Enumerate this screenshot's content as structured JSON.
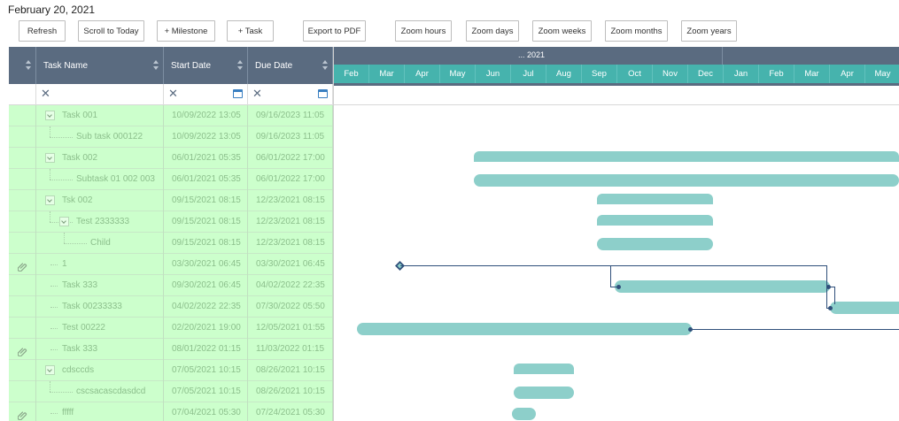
{
  "header": {
    "date": "February 20, 2021"
  },
  "toolbar": {
    "buttons": [
      {
        "label": "Refresh"
      },
      {
        "label": "Scroll to Today"
      },
      {
        "label": "+ Milestone"
      },
      {
        "label": "+ Task"
      },
      {
        "label": "Export to PDF"
      },
      {
        "label": "Zoom hours"
      },
      {
        "label": "Zoom days"
      },
      {
        "label": "Zoom weeks"
      },
      {
        "label": "Zoom months"
      },
      {
        "label": "Zoom years"
      }
    ]
  },
  "grid": {
    "columns": {
      "name": "Task Name",
      "start": "Start Date",
      "due": "Due Date"
    },
    "rows": [
      {
        "name": "Task 001",
        "start": "10/09/2022 13:05",
        "due": "09/16/2023 11:05",
        "level": 1,
        "expandable": true,
        "attachment": false
      },
      {
        "name": "Sub task 000122",
        "start": "10/09/2022 13:05",
        "due": "09/16/2023 11:05",
        "level": 2,
        "expandable": false,
        "attachment": false
      },
      {
        "name": "Task 002",
        "start": "06/01/2021 05:35",
        "due": "06/01/2022 17:00",
        "level": 1,
        "expandable": true,
        "attachment": false
      },
      {
        "name": "Subtask 01 002 003",
        "start": "06/01/2021 05:35",
        "due": "06/01/2022 17:00",
        "level": 2,
        "expandable": false,
        "attachment": false
      },
      {
        "name": "Tsk 002",
        "start": "09/15/2021 08:15",
        "due": "12/23/2021 08:15",
        "level": 1,
        "expandable": true,
        "attachment": false
      },
      {
        "name": "Test 2333333",
        "start": "09/15/2021 08:15",
        "due": "12/23/2021 08:15",
        "level": 2,
        "expandable": true,
        "attachment": false
      },
      {
        "name": "Child",
        "start": "09/15/2021 08:15",
        "due": "12/23/2021 08:15",
        "level": 3,
        "expandable": false,
        "attachment": false
      },
      {
        "name": "1",
        "start": "03/30/2021 06:45",
        "due": "03/30/2021 06:45",
        "level": 1,
        "expandable": false,
        "attachment": true
      },
      {
        "name": "Task 333",
        "start": "09/30/2021 06:45",
        "due": "04/02/2022 22:35",
        "level": 1,
        "expandable": false,
        "attachment": false
      },
      {
        "name": "Task 00233333",
        "start": "04/02/2022 22:35",
        "due": "07/30/2022 05:50",
        "level": 1,
        "expandable": false,
        "attachment": false
      },
      {
        "name": "Test 00222",
        "start": "02/20/2021 19:00",
        "due": "12/05/2021 01:55",
        "level": 1,
        "expandable": false,
        "attachment": false
      },
      {
        "name": "Task 333",
        "start": "08/01/2022 01:15",
        "due": "11/03/2022 01:15",
        "level": 1,
        "expandable": false,
        "attachment": true
      },
      {
        "name": "cdsccds",
        "start": "07/05/2021 10:15",
        "due": "08/26/2021 10:15",
        "level": 1,
        "expandable": true,
        "attachment": false
      },
      {
        "name": "cscsacascdasdcd",
        "start": "07/05/2021 10:15",
        "due": "08/26/2021 10:15",
        "level": 2,
        "expandable": false,
        "attachment": false
      },
      {
        "name": "fffff",
        "start": "07/04/2021 05:30",
        "due": "07/24/2021 05:30",
        "level": 1,
        "expandable": false,
        "attachment": true
      }
    ]
  },
  "timeline": {
    "year_label": "... 2021",
    "months": [
      "Feb",
      "Mar",
      "Apr",
      "May",
      "Jun",
      "Jul",
      "Aug",
      "Sep",
      "Oct",
      "Nov",
      "Dec",
      "Jan",
      "Feb",
      "Mar",
      "Apr",
      "May"
    ]
  },
  "colors": {
    "grid_header": "#5a6b80",
    "timeline_months": "#46b3ad",
    "row_background": "#ccffcc",
    "bar": "#8dcfca",
    "dependency_line": "#2f4f7a"
  }
}
